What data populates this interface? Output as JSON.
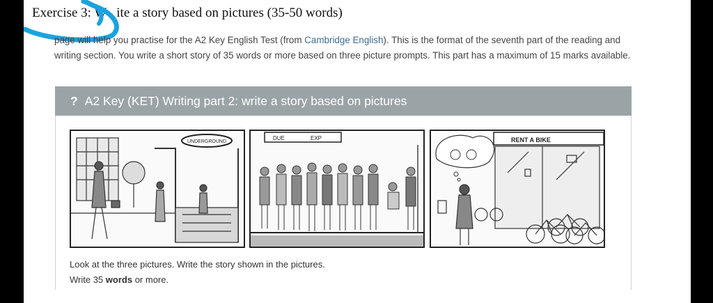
{
  "title": {
    "prefix": "Exercise 3: W",
    "suffix": "ite a story based on pictures (35-50 words)"
  },
  "intro": {
    "part1": "page will help you practise for the A2 Key English Test (from ",
    "link": "Cambridge English",
    "part2": "). This is the format of the seventh part of the reading and writing section. You write a short story of 35 words or more based on three picture prompts. This part has a maximum of 15 marks available."
  },
  "panel": {
    "icon": "?",
    "heading": "A2 Key (KET) Writing part 2: write a story based on pictures"
  },
  "pictures": {
    "p1_sign": "UNDERGROUND",
    "p2_sign_a": "DUE",
    "p2_sign_b": "EXP",
    "p3_sign": "RENT A BIKE"
  },
  "instructions": {
    "line1": "Look at the three pictures. Write the story shown in the pictures.",
    "line2_before": "Write 35 ",
    "line2_bold": "words",
    "line2_after": " or more."
  },
  "colors": {
    "panel_header": "#9aa4a6",
    "link": "#3a6c93",
    "scribble": "#1aa3e0"
  }
}
